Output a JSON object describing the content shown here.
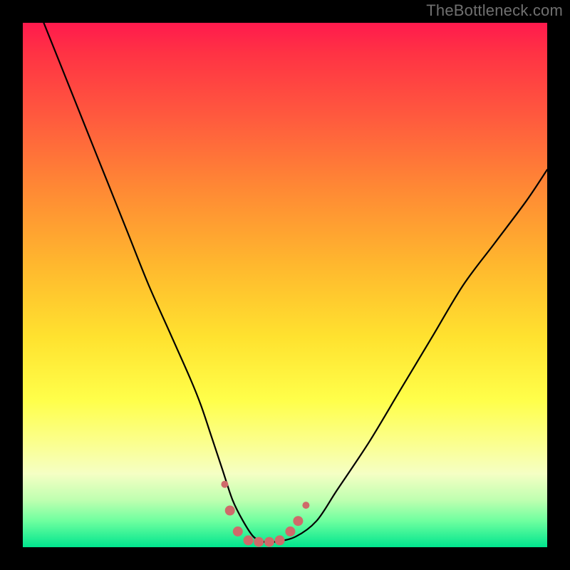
{
  "watermark": "TheBottleneck.com",
  "chart_data": {
    "type": "line",
    "title": "",
    "xlabel": "",
    "ylabel": "",
    "xlim": [
      0,
      100
    ],
    "ylim": [
      0,
      100
    ],
    "series": [
      {
        "name": "bottleneck-curve",
        "x": [
          4,
          8,
          12,
          16,
          20,
          24,
          28,
          32,
          34,
          36,
          38,
          40,
          42,
          44,
          46,
          48,
          52,
          56,
          60,
          66,
          72,
          78,
          84,
          90,
          96,
          100
        ],
        "values": [
          100,
          90,
          80,
          70,
          60,
          50,
          41,
          32,
          27,
          21,
          15,
          9,
          5,
          2,
          1,
          1,
          2,
          5,
          11,
          20,
          30,
          40,
          50,
          58,
          66,
          72
        ]
      }
    ],
    "markers": {
      "name": "valley-points",
      "color": "#cf6a6a",
      "radius_major": 7,
      "radius_minor": 5,
      "points": [
        {
          "x": 38.5,
          "y": 12
        },
        {
          "x": 39.5,
          "y": 7
        },
        {
          "x": 41,
          "y": 3
        },
        {
          "x": 43,
          "y": 1.3
        },
        {
          "x": 45,
          "y": 1
        },
        {
          "x": 47,
          "y": 1
        },
        {
          "x": 49,
          "y": 1.3
        },
        {
          "x": 51,
          "y": 3
        },
        {
          "x": 52.5,
          "y": 5
        },
        {
          "x": 54,
          "y": 8
        }
      ]
    }
  }
}
